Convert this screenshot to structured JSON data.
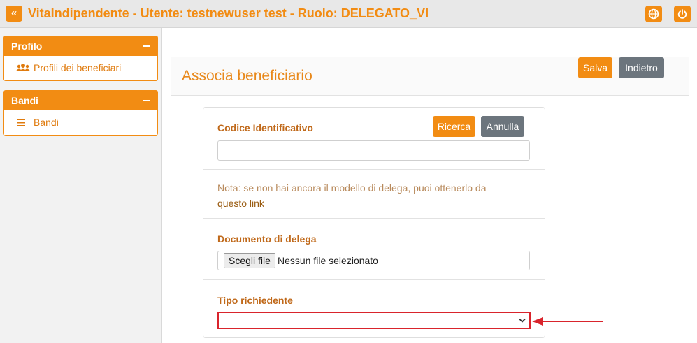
{
  "header": {
    "collapse_icon": "double-chevron-left-icon",
    "title": "VitaIndipendente - Utente: testnewuser test - Ruolo: DELEGATO_VI",
    "globe_icon": "globe-icon",
    "power_icon": "power-icon",
    "accent": "#f28c13"
  },
  "sidebar": {
    "panels": [
      {
        "title": "Profilo",
        "items": [
          {
            "label": "Profili dei beneficiari",
            "icon": "users-icon"
          }
        ]
      },
      {
        "title": "Bandi",
        "items": [
          {
            "label": "Bandi",
            "icon": "list-icon"
          }
        ]
      }
    ]
  },
  "main": {
    "title": "Associa beneficiario",
    "save_label": "Salva",
    "back_label": "Indietro"
  },
  "form": {
    "codice_label": "Codice Identificativo",
    "search_label": "Ricerca",
    "cancel_label": "Annulla",
    "codice_value": "",
    "note_text": "Nota: se non hai ancora il modello di delega, puoi ottenerlo da",
    "note_link": "questo link",
    "document_label": "Documento di delega",
    "file_button": "Scegli file",
    "file_status": "Nessun file selezionato",
    "tipo_label": "Tipo richiedente",
    "tipo_value": ""
  },
  "annotation": {
    "color": "#d9242c"
  }
}
